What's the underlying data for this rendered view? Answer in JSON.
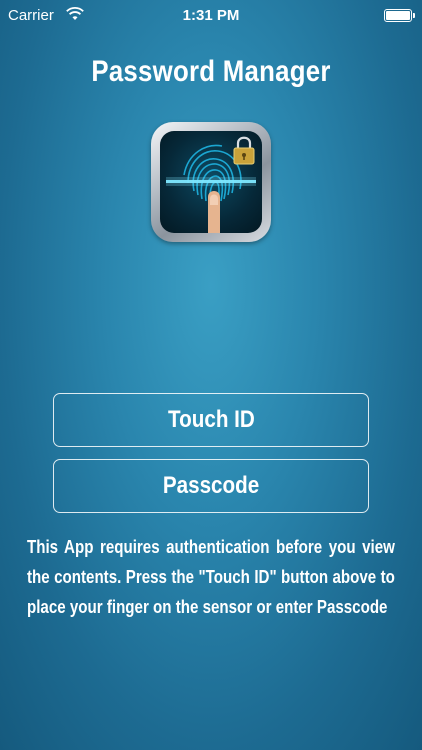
{
  "status_bar": {
    "carrier": "Carrier",
    "time": "1:31 PM"
  },
  "header": {
    "title": "Password Manager"
  },
  "app_icon": {
    "icon": "fingerprint-lock-icon"
  },
  "buttons": {
    "touch_id": "Touch ID",
    "passcode": "Passcode"
  },
  "description": "This App requires authentication before you view the contents. Press the \"Touch ID\" button above to place your finger on the sensor or enter Passcode",
  "colors": {
    "background": "#2a86ae",
    "text": "#ffffff",
    "scan_line": "#7fe8ff"
  }
}
